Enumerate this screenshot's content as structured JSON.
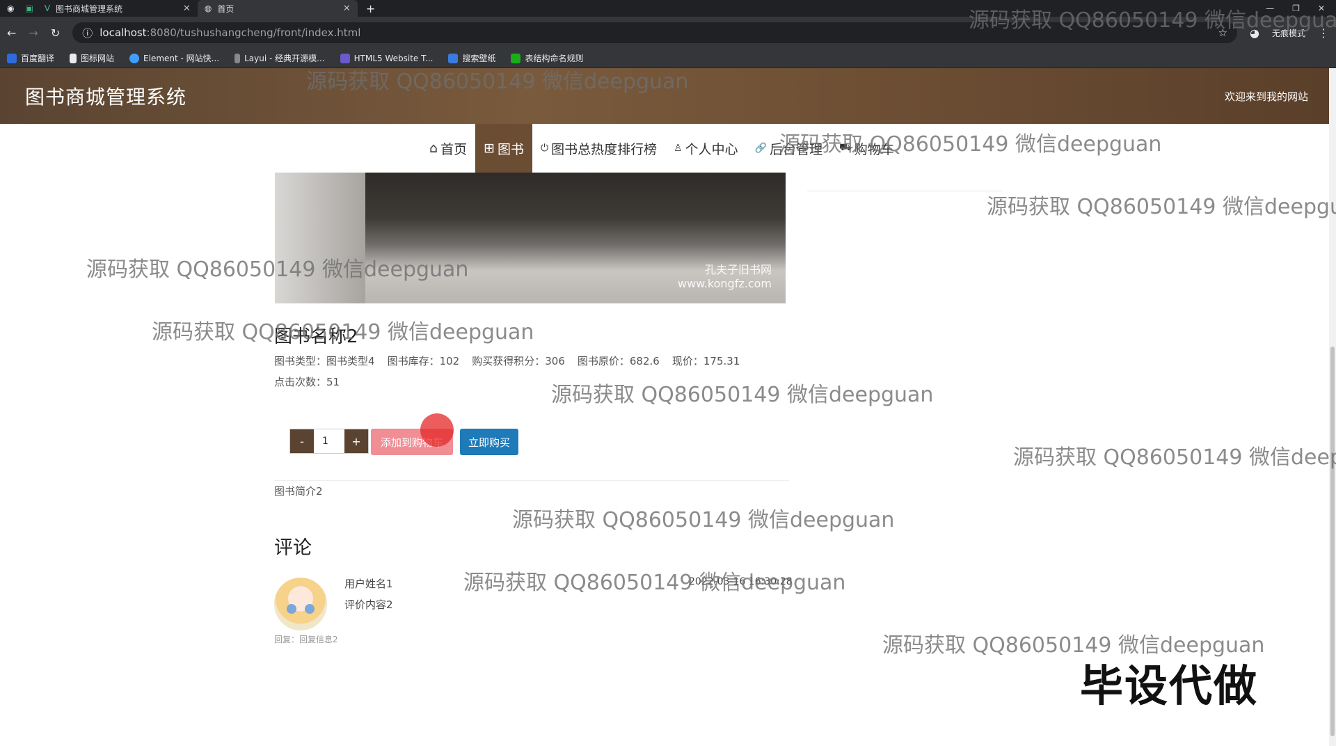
{
  "browser": {
    "tabs": [
      {
        "title": "图书商城管理系统"
      },
      {
        "title": "首页"
      }
    ],
    "new_tab": "+",
    "url_host": "localhost",
    "url_path": ":8080/tushushangcheng/front/index.html",
    "incognito_label": "无痕模式",
    "bookmarks": [
      "百度翻译",
      "图标网站",
      "Element - 网站快...",
      "Layui - 经典开源模...",
      "HTML5 Website T...",
      "搜索壁纸",
      "表结构命名规则"
    ]
  },
  "header": {
    "title": "图书商城管理系统",
    "welcome": "欢迎来到我的网站"
  },
  "nav": [
    {
      "icon": "home-icon",
      "glyph": "⌂",
      "label": "首页"
    },
    {
      "icon": "grid-icon",
      "glyph": "⊞",
      "label": "图书",
      "active": true
    },
    {
      "icon": "power-icon",
      "glyph": "⏻",
      "label": "图书总热度排行榜"
    },
    {
      "icon": "user-icon",
      "glyph": "♙",
      "label": "个人中心"
    },
    {
      "icon": "link-icon",
      "glyph": "🔗",
      "label": "后台管理"
    },
    {
      "icon": "cart-icon",
      "glyph": "⛟",
      "label": "购物车"
    }
  ],
  "book": {
    "image_watermark_line1": "孔夫子旧书网",
    "image_watermark_line2": "www.kongfz.com",
    "name": "图书名称2",
    "type_label": "图书类型：",
    "type_value": "图书类型4",
    "stock_label": "图书库存：",
    "stock_value": "102",
    "points_label": "购买获得积分：",
    "points_value": "306",
    "original_price_label": "图书原价：",
    "original_price_value": "682.6",
    "price_label": "现价：",
    "price_value": "175.31",
    "clicks_label": "点击次数：",
    "clicks_value": "51",
    "quantity": "1",
    "minus": "-",
    "plus": "+",
    "add_to_cart": "添加到购物车",
    "buy_now": "立即购买",
    "intro": "图书简介2"
  },
  "comments": {
    "title": "评论",
    "items": [
      {
        "user": "用户姓名1",
        "content": "评价内容2",
        "time": "2022-03-16 16:30:28",
        "reply": "回复：回复信息2"
      }
    ]
  },
  "watermarks": [
    "源码获取 QQ86050149 微信deepguan",
    "源码获取 QQ86050149 微信deepguan",
    "源码获取 QQ86050149 微信deepguan",
    "源码获取 QQ86050149 微信deepgu",
    "源码获取 QQ86050149 微信deepguan",
    "源码获取 QQ86050149 微信deepguan",
    "源码获取 QQ86050149 微信deepguan",
    "源码获取 QQ86050149 微信deep",
    "源码获取 QQ86050149 微信deepguan",
    "源码获取 QQ86050149 微信deepguan",
    "源码获取 QQ86050149 微信deepguan"
  ],
  "promo": "毕设代做"
}
